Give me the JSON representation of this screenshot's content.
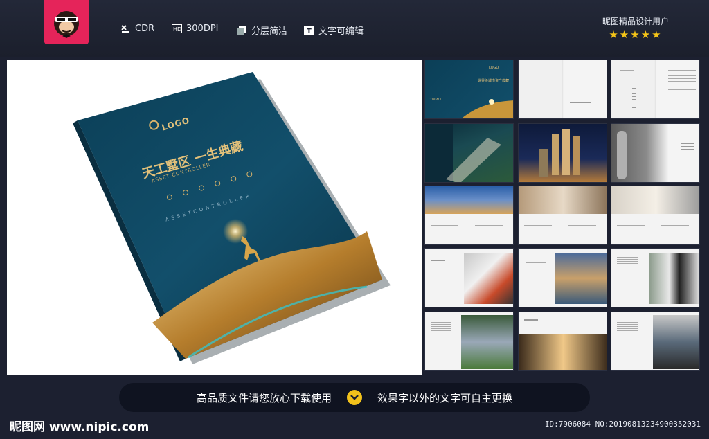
{
  "header": {
    "features": [
      {
        "label": "CDR",
        "icon": "cdr-icon"
      },
      {
        "label": "300DPI",
        "icon": "hd-icon"
      },
      {
        "label": "分层简洁",
        "icon": "layers-icon"
      },
      {
        "label": "文字可编辑",
        "icon": "text-icon"
      }
    ],
    "user_label": "昵图精品设计用户",
    "stars": "★★★★★",
    "star_rating": 5
  },
  "cover": {
    "logo_text": "LOGO",
    "title": "天工墅区 一生典藏",
    "subtitle": "ASSET CONTROLLER",
    "tagline": "ASSETCONTROLLER"
  },
  "thumb_page1": {
    "logo_text": "LOGO",
    "line1": "世界级城市资产典藏",
    "line2": "CONTACT"
  },
  "bottom": {
    "left_text": "高品质文件请您放心下载使用",
    "right_text": "效果字以外的文字可自主更换"
  },
  "footer": {
    "site": "昵图网 www.nipic.com",
    "id_text": "ID:7906084 NO:20190813234900352031"
  },
  "colors": {
    "background": "#1c2030",
    "brand": "#e5245a",
    "star": "#f5c518",
    "cover_blue": "#0f4f6a",
    "gold": "#c8963a"
  }
}
